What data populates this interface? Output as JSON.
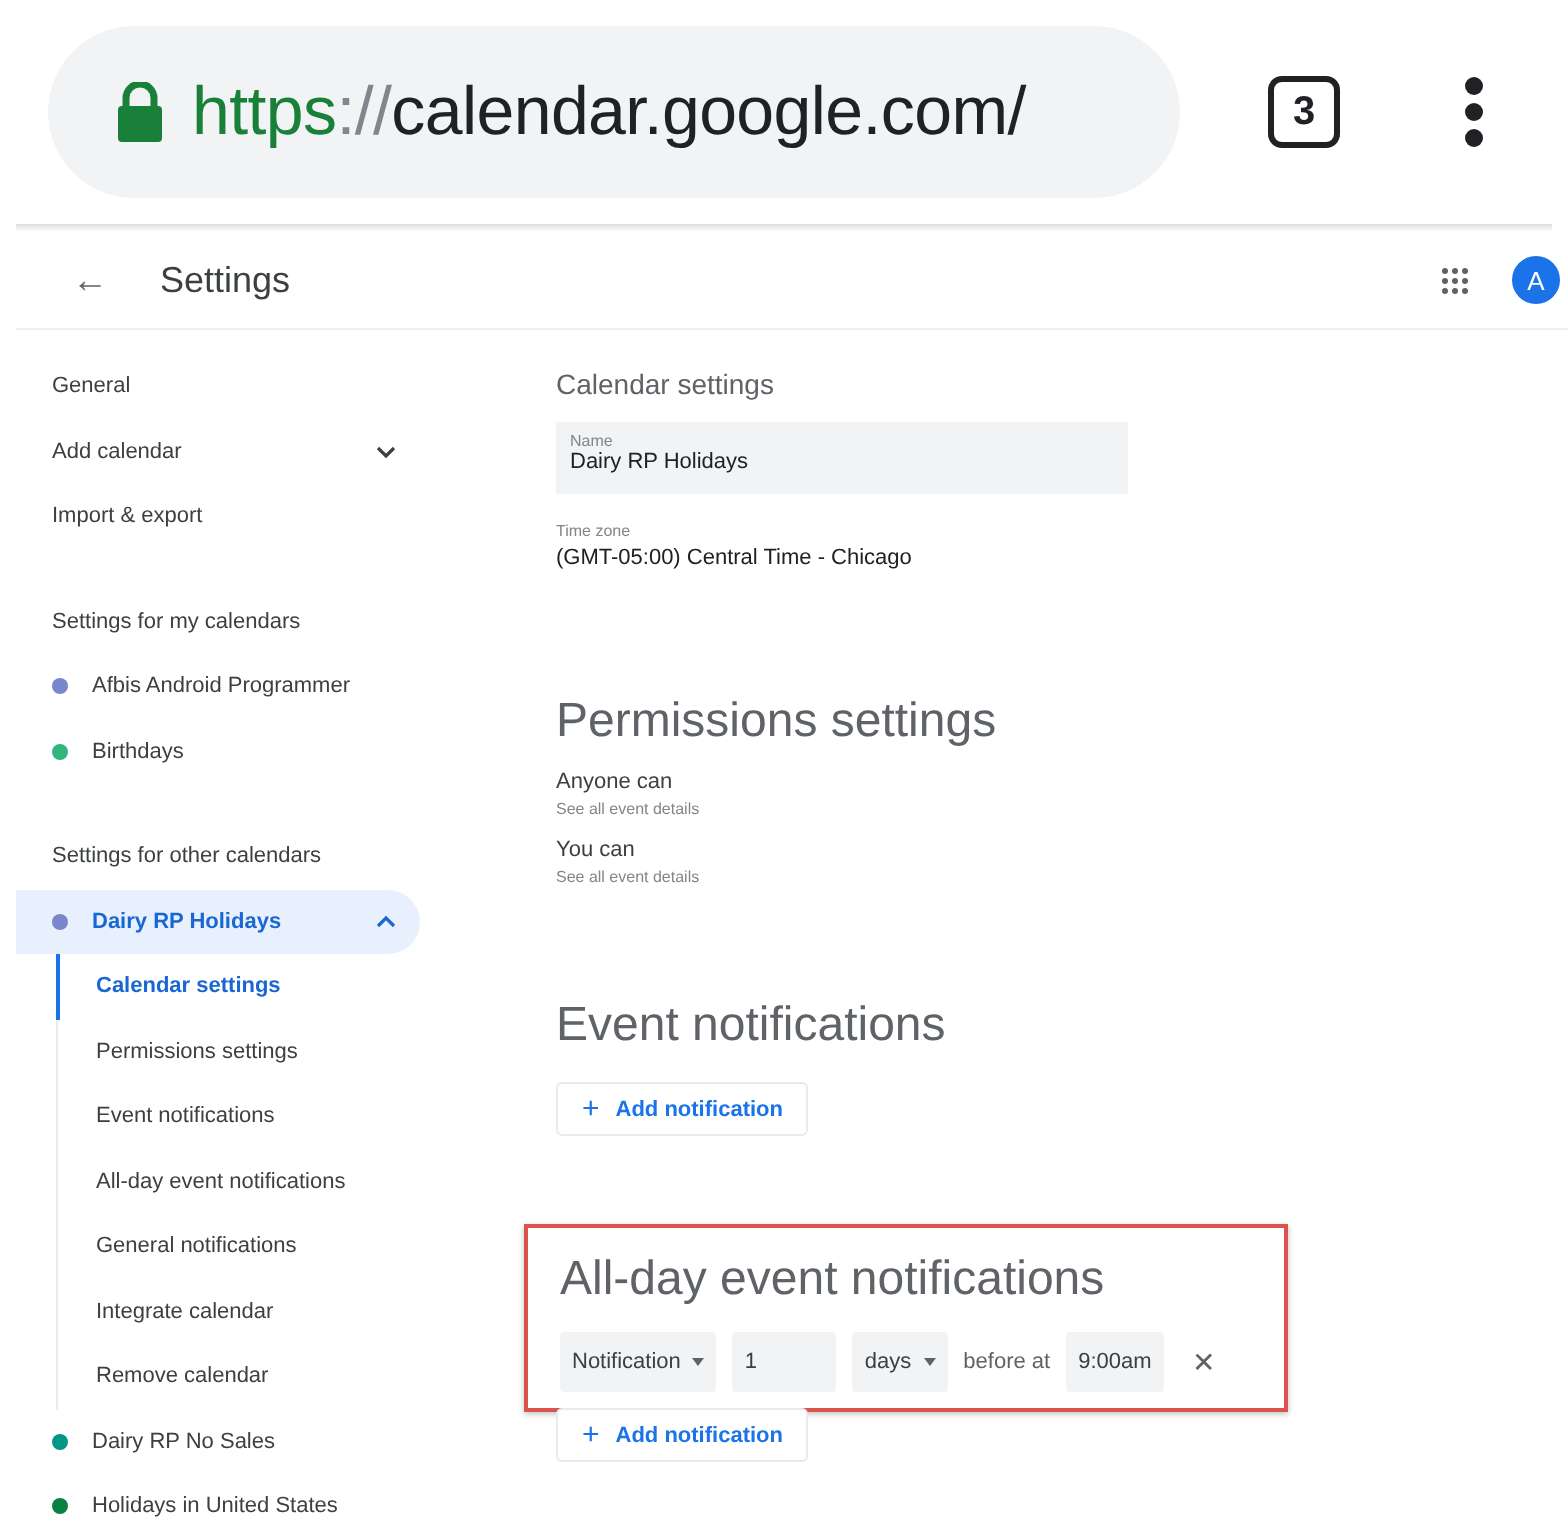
{
  "browser": {
    "url_scheme": "https",
    "url_separator": "://",
    "url_host": "calendar.google.com/",
    "secure": true,
    "tab_count": "3"
  },
  "header": {
    "back": "←",
    "title": "Settings",
    "avatar": "A"
  },
  "sidebar": {
    "items": [
      {
        "kind": "link",
        "label": "General"
      },
      {
        "kind": "expander",
        "label": "Add calendar",
        "expanded": false
      },
      {
        "kind": "link",
        "label": "Import & export"
      },
      {
        "kind": "heading",
        "label": "Settings for my calendars"
      },
      {
        "kind": "calendar",
        "label": "Afbis Android Programmer",
        "color": "#7986cb",
        "selected": false,
        "expanded": false
      },
      {
        "kind": "calendar",
        "label": "Birthdays",
        "color": "#33b679",
        "selected": false,
        "expanded": false
      },
      {
        "kind": "heading",
        "label": "Settings for other calendars"
      },
      {
        "kind": "calendar",
        "label": "Dairy RP Holidays",
        "color": "#7986cb",
        "selected": true,
        "expanded": true,
        "children": [
          {
            "label": "Calendar settings",
            "selected": true
          },
          {
            "label": "Permissions settings",
            "selected": false
          },
          {
            "label": "Event notifications",
            "selected": false
          },
          {
            "label": "All-day event notifications",
            "selected": false
          },
          {
            "label": "General notifications",
            "selected": false
          },
          {
            "label": "Integrate calendar",
            "selected": false
          },
          {
            "label": "Remove calendar",
            "selected": false
          }
        ]
      },
      {
        "kind": "calendar",
        "label": "Dairy RP No Sales",
        "color": "#009688",
        "selected": false,
        "expanded": false
      },
      {
        "kind": "calendar",
        "label": "Holidays in United States",
        "color": "#0b8043",
        "selected": false,
        "expanded": false
      }
    ]
  },
  "calendar_settings": {
    "title": "Calendar settings",
    "name_label": "Name",
    "name_value": "Dairy RP Holidays",
    "timezone_label": "Time zone",
    "timezone_value": "(GMT-05:00) Central Time - Chicago"
  },
  "permissions": {
    "title": "Permissions settings",
    "rows": [
      {
        "label": "Anyone can",
        "value": "See all event details"
      },
      {
        "label": "You can",
        "value": "See all event details"
      }
    ]
  },
  "event_notifications": {
    "title": "Event notifications",
    "add_icon": "+",
    "add_button": "Add notification"
  },
  "all_day_notifications": {
    "title": "All-day event notifications",
    "highlighted": true,
    "row": {
      "type": "Notification",
      "amount": "1",
      "unit": "days",
      "before_at": "before at",
      "time": "9:00am",
      "remove": "✕"
    },
    "add_icon": "+",
    "add_button": "Add notification"
  }
}
